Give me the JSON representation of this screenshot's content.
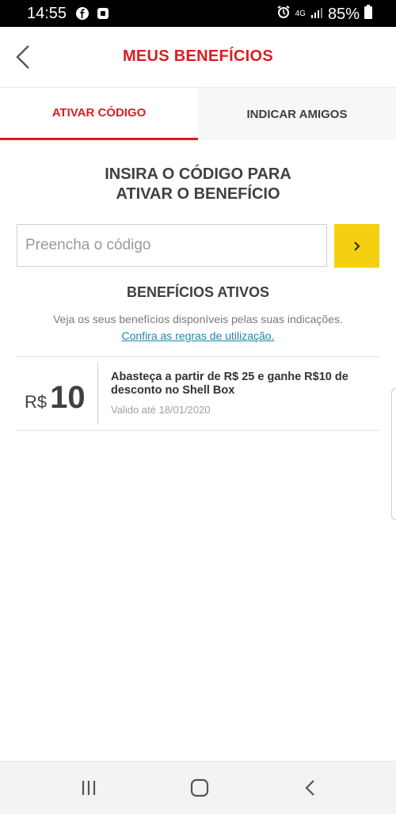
{
  "status_bar": {
    "time": "14:55",
    "network": "4G",
    "battery": "85%",
    "left_icons": [
      "facebook-icon",
      "notification-icon"
    ],
    "right_icons": [
      "alarm-icon",
      "signal-icon",
      "battery-icon"
    ]
  },
  "header": {
    "title": "MEUS BENEFÍCIOS",
    "back_icon": "chevron-left-icon"
  },
  "tabs": [
    {
      "label": "ATIVAR CÓDIGO",
      "active": true
    },
    {
      "label": "INDICAR AMIGOS",
      "active": false
    }
  ],
  "activate": {
    "heading_line1": "INSIRA O CÓDIGO PARA",
    "heading_line2": "ATIVAR O BENEFÍCIO",
    "input_placeholder": "Preencha o código",
    "input_value": "",
    "submit_icon": "chevron-right-icon"
  },
  "active_benefits": {
    "title": "BENEFÍCIOS ATIVOS",
    "subtitle": "Veja os seus benefícios disponíveis pelas suas indicações.",
    "rules_link": "Confira as regras de utilização.",
    "items": [
      {
        "currency": "R$",
        "amount": "10",
        "description": "Abasteça a partir de R$ 25 e ganhe R$10 de desconto no Shell Box",
        "valid_until": "Valido até 18/01/2020"
      }
    ]
  },
  "nav_bar": {
    "buttons": [
      "recent-apps-icon",
      "home-icon",
      "back-icon"
    ]
  },
  "colors": {
    "brand_red": "#dd1d21",
    "brand_yellow": "#f5d010",
    "link": "#1a8aa6",
    "text_dark": "#404040"
  }
}
